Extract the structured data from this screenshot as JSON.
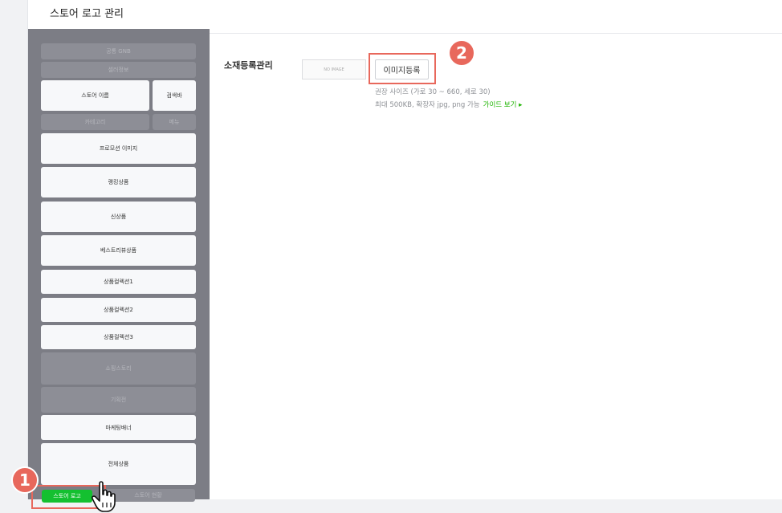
{
  "page_title": "스토어 로고 관리",
  "layout": {
    "gnb": "공통 GNB",
    "seller_info": "셀러정보",
    "store_name": "스토어 이름",
    "search_bar": "검색바",
    "category": "카테고리",
    "menu": "메뉴",
    "promotion_image": "프로모션 이미지",
    "ranking_products": "랭킹상품",
    "new_products": "신상품",
    "best_review_products": "베스트리뷰상품",
    "collection1": "상품컬렉션1",
    "collection2": "상품컬렉션2",
    "collection3": "상품컬렉션3",
    "shopping_story": "쇼핑스토리",
    "exhibition": "기획전",
    "marketing_banner": "마케팅배너",
    "all_products": "전체상품",
    "store_logo": "스토어 로고",
    "store_status": "스토어 현황"
  },
  "content": {
    "section_label": "소재등록관리",
    "no_image": "NO IMAGE",
    "register_button": "이미지등록",
    "hint_size": "권장 사이즈 (가로 30 ~ 660, 세로 30)",
    "hint_file": "최대 500KB, 확장자 jpg, png 가능",
    "guide_link": "가이드 보기 ▸"
  },
  "badges": {
    "step1": "1",
    "step2": "2"
  },
  "icons": {
    "cursor": "hand-pointer-icon"
  },
  "colors": {
    "accent": "#e8685c",
    "green": "#14c030",
    "link_green": "#1db400",
    "panel": "#7c7d85"
  }
}
